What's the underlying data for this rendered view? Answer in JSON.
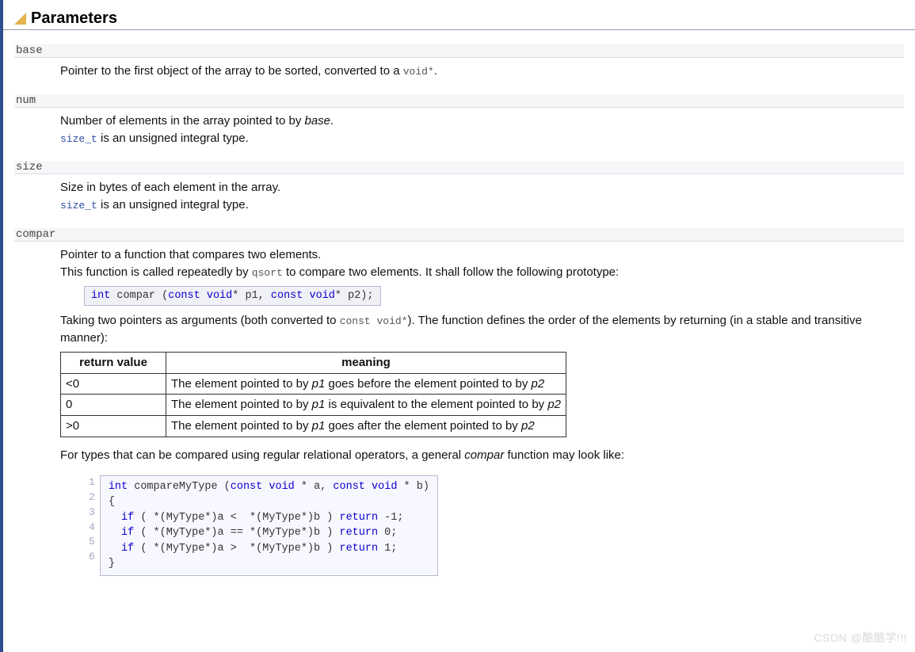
{
  "section_title": "Parameters",
  "params": {
    "base": {
      "name": "base",
      "desc_before": "Pointer to the first object of the array to be sorted, converted to a ",
      "desc_code": "void*",
      "desc_after": "."
    },
    "num": {
      "name": "num",
      "line1_before": "Number of elements in the array pointed to by ",
      "line1_italic": "base",
      "line1_after": ".",
      "line2_link": "size_t",
      "line2_rest": " is an unsigned integral type."
    },
    "size": {
      "name": "size",
      "line1": "Size in bytes of each element in the array.",
      "line2_link": "size_t",
      "line2_rest": " is an unsigned integral type."
    },
    "compar": {
      "name": "compar",
      "line1": "Pointer to a function that compares two elements.",
      "line2_a": "This function is called repeatedly by ",
      "line2_code": "qsort",
      "line2_b": " to compare two elements. It shall follow the following prototype:",
      "proto": {
        "t1": "int",
        "sp1": " compar (",
        "t2": "const",
        "sp2": " ",
        "t3": "void",
        "sp3": "* p1, ",
        "t4": "const",
        "sp4": " ",
        "t5": "void",
        "sp5": "* p2);"
      },
      "para2_a": "Taking two pointers as arguments (both converted to ",
      "para2_code": "const void*",
      "para2_b": "). The function defines the order of the elements by returning (in a stable and transitive manner):",
      "table": {
        "h1": "return value",
        "h2": "meaning",
        "rows": [
          {
            "rv": "<0",
            "a": "The element pointed to by ",
            "p1": "p1",
            "b": " goes before the element pointed to by ",
            "p2": "p2"
          },
          {
            "rv": "0",
            "a": "The element pointed to by ",
            "p1": "p1",
            "b": " is equivalent to the element pointed to by ",
            "p2": "p2"
          },
          {
            "rv": ">0",
            "a": "The element pointed to by ",
            "p1": "p1",
            "b": " goes after the element pointed to by ",
            "p2": "p2"
          }
        ]
      },
      "para3_a": "For types that can be compared using regular relational operators, a general ",
      "para3_i": "compar",
      "para3_b": " function may look like:",
      "code": {
        "lines": [
          "1",
          "2",
          "3",
          "4",
          "5",
          "6"
        ],
        "l1": {
          "a": "int",
          "b": " compareMyType (",
          "c": "const",
          "d": " ",
          "e": "void",
          "f": " * a, ",
          "g": "const",
          "h": " ",
          "i": "void",
          "j": " * b)"
        },
        "l2": "{",
        "l3": {
          "a": "  ",
          "b": "if",
          "c": " ( *(MyType*)a <  *(MyType*)b ) ",
          "d": "return",
          "e": " -1;"
        },
        "l4": {
          "a": "  ",
          "b": "if",
          "c": " ( *(MyType*)a == *(MyType*)b ) ",
          "d": "return",
          "e": " 0;"
        },
        "l5": {
          "a": "  ",
          "b": "if",
          "c": " ( *(MyType*)a >  *(MyType*)b ) ",
          "d": "return",
          "e": " 1;"
        },
        "l6": "}"
      }
    }
  },
  "watermark": "CSDN @酷酷学!!!"
}
